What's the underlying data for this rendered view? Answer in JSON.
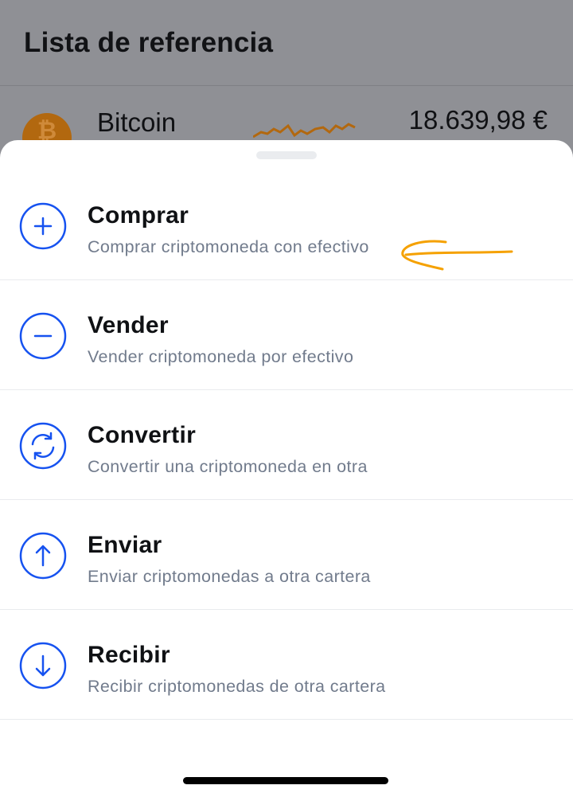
{
  "background": {
    "title": "Lista de referencia",
    "coin": {
      "name": "Bitcoin",
      "price": "18.639,98 €",
      "icon": "bitcoin-icon",
      "icon_glyph": "₿"
    }
  },
  "sheet": {
    "actions": [
      {
        "title": "Comprar",
        "subtitle": "Comprar criptomoneda con efectivo",
        "icon": "plus-circle-icon"
      },
      {
        "title": "Vender",
        "subtitle": "Vender criptomoneda por efectivo",
        "icon": "minus-circle-icon"
      },
      {
        "title": "Convertir",
        "subtitle": "Convertir una criptomoneda en otra",
        "icon": "convert-circle-icon"
      },
      {
        "title": "Enviar",
        "subtitle": "Enviar criptomonedas a otra cartera",
        "icon": "arrow-up-circle-icon"
      },
      {
        "title": "Recibir",
        "subtitle": "Recibir criptomonedas de otra cartera",
        "icon": "arrow-down-circle-icon"
      }
    ]
  },
  "colors": {
    "accent": "#1652f0",
    "annotation": "#f5a100",
    "bitcoin": "#b2680f"
  }
}
